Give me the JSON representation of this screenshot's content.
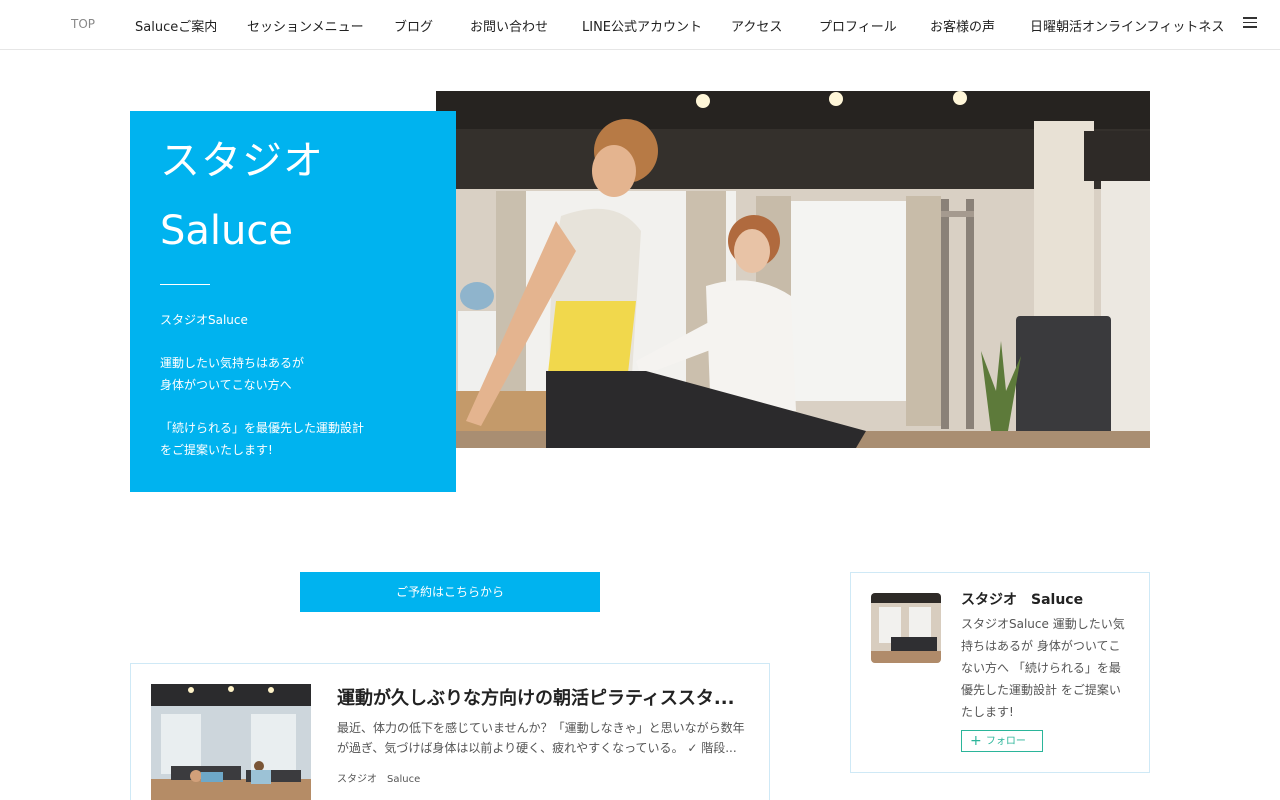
{
  "nav": {
    "items": [
      "TOP",
      "Saluceご案内",
      "セッションメニュー",
      "ブログ",
      "お問い合わせ",
      "LINE公式アカウント",
      "アクセス",
      "プロフィール",
      "お客様の声",
      "日曜朝活オンラインフィットネス"
    ],
    "menu_icon": "hamburger-menu-icon"
  },
  "hero": {
    "title_line1": "スタジオ",
    "title_line2": "Saluce",
    "text": [
      "スタジオSaluce",
      "",
      "運動したい気持ちはあるが",
      "身体がついてこない方へ",
      "",
      "「続けられる」を最優先した運動設計",
      "をご提案いたします!"
    ],
    "accent_color": "#00b3ef"
  },
  "booking": {
    "label": "ご予約はこちらから"
  },
  "post": {
    "title": "運動が久しぶりな方向けの朝活ピラティススタ...",
    "excerpt": "最近、体力の低下を感じていませんか？「運動しなきゃ」と思いながら数年が過ぎ、気づけば身体は以前より硬く、疲れやすくなっている。 ✓ 階段...",
    "author": "スタジオ　Saluce"
  },
  "profile": {
    "name": "スタジオ　Saluce",
    "description": "スタジオSaluce 運動したい気持ちはあるが 身体がついてこない方へ 「続けられる」を最優先した運動設計 をご提案いたします!",
    "follow_label": "フォロー",
    "follow_color": "#2bb59a"
  }
}
